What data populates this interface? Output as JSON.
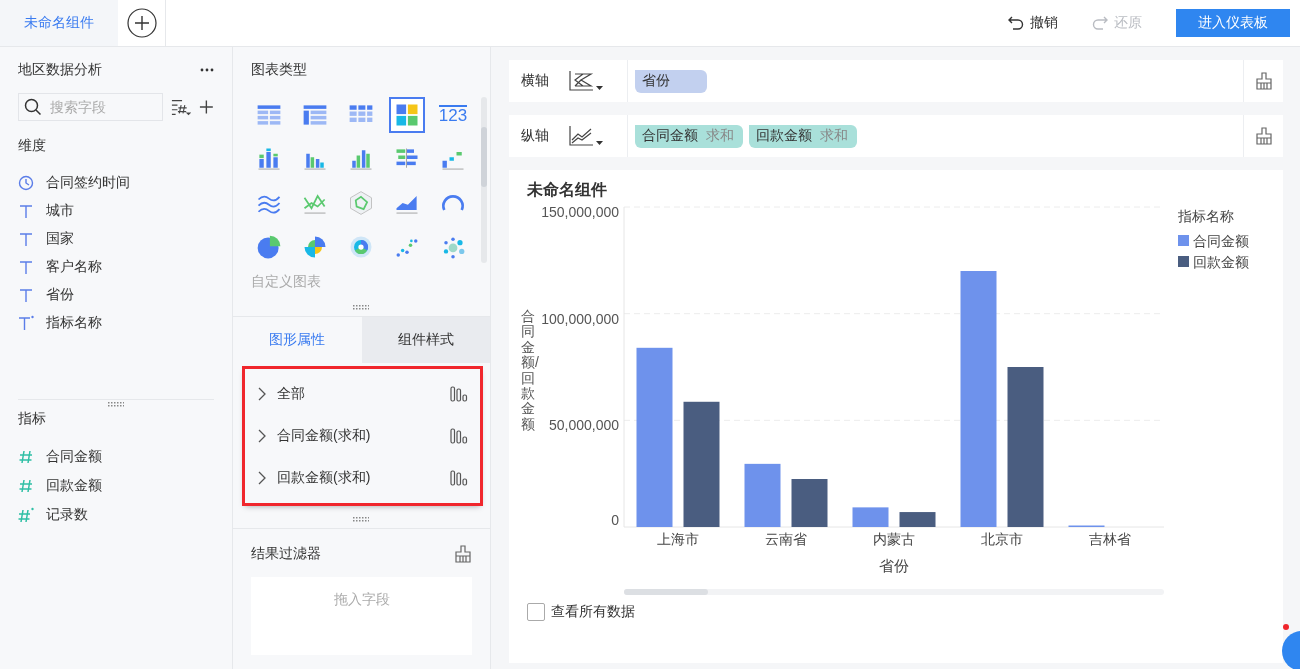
{
  "top_bar": {
    "tabs": [
      {
        "label": "未命名组件",
        "selected": true
      }
    ],
    "undo": {
      "label": "撤销",
      "disabled": false
    },
    "redo": {
      "label": "还原",
      "disabled": true
    },
    "primary_button": "进入仪表板"
  },
  "data_panel": {
    "title": "地区数据分析",
    "search": {
      "placeholder": "搜索字段"
    },
    "dimensions": {
      "title": "维度",
      "fields": [
        {
          "name": "合同签约时间",
          "kind": "time"
        },
        {
          "name": "城市",
          "kind": "text"
        },
        {
          "name": "国家",
          "kind": "text"
        },
        {
          "name": "客户名称",
          "kind": "text"
        },
        {
          "name": "省份",
          "kind": "text"
        },
        {
          "name": "指标名称",
          "kind": "text-calc"
        }
      ]
    },
    "measures": {
      "title": "指标",
      "fields": [
        {
          "name": "合同金额",
          "kind": "number"
        },
        {
          "name": "回款金额",
          "kind": "number"
        },
        {
          "name": "记录数",
          "kind": "number-calc"
        }
      ]
    }
  },
  "chart_types": {
    "title": "图表类型",
    "types": [
      {
        "kind": "table",
        "selected": false
      },
      {
        "kind": "crosstable",
        "selected": false
      },
      {
        "kind": "detail",
        "selected": false
      },
      {
        "kind": "blocks",
        "selected": true
      },
      {
        "kind": "kpi",
        "label": "123",
        "selected": false
      },
      {
        "kind": "stackedbar",
        "selected": false
      },
      {
        "kind": "groupedbar",
        "selected": false
      },
      {
        "kind": "bar",
        "selected": false
      },
      {
        "kind": "hbar",
        "selected": false
      },
      {
        "kind": "steps",
        "selected": false
      },
      {
        "kind": "lines",
        "selected": false
      },
      {
        "kind": "linepoint",
        "selected": false
      },
      {
        "kind": "radar",
        "selected": false
      },
      {
        "kind": "area",
        "selected": false
      },
      {
        "kind": "gauge",
        "selected": false
      },
      {
        "kind": "pie",
        "selected": false
      },
      {
        "kind": "rose",
        "selected": false
      },
      {
        "kind": "donut",
        "selected": false
      },
      {
        "kind": "scatter",
        "selected": false
      },
      {
        "kind": "bubble",
        "selected": false
      }
    ],
    "custom_label": "自定义图表"
  },
  "properties": {
    "highlighted": true,
    "tabs": [
      {
        "label": "图形属性",
        "selected": true
      },
      {
        "label": "组件样式",
        "selected": false
      }
    ],
    "items": [
      {
        "label": "全部",
        "expanded": false
      },
      {
        "label": "合同金额(求和)",
        "expanded": false
      },
      {
        "label": "回款金额(求和)",
        "expanded": false
      }
    ]
  },
  "result_filter": {
    "title": "结果过滤器",
    "placeholder": "拖入字段"
  },
  "axes": [
    {
      "label": "横轴",
      "kind": "x",
      "pills": [
        {
          "field": "省份",
          "kind": "dimension"
        }
      ]
    },
    {
      "label": "纵轴",
      "kind": "y",
      "pills": [
        {
          "field": "合同金额",
          "aggregation": "求和",
          "kind": "measure"
        },
        {
          "field": "回款金额",
          "aggregation": "求和",
          "kind": "measure"
        }
      ]
    }
  ],
  "widget": {
    "title": "未命名组件",
    "chart_data": {
      "type": "bar",
      "legend": {
        "title": "指标名称"
      },
      "xlabel": "省份",
      "ylabel": "合同金额/回款金额",
      "categories": [
        "上海市",
        "云南省",
        "内蒙古",
        "北京市",
        "吉林省"
      ],
      "series": [
        {
          "name": "合同金额",
          "color": "#6e92ec",
          "values": [
            84000000,
            29600000,
            9200000,
            120000000,
            700000
          ]
        },
        {
          "name": "回款金额",
          "color": "#4a5d80",
          "values": [
            58700000,
            22500000,
            7000000,
            75000000,
            0
          ]
        }
      ],
      "ylim": [
        0,
        150000000
      ],
      "yticks": [
        {
          "value": 0,
          "label": "0"
        },
        {
          "value": 50000000,
          "label": "50,000,000"
        },
        {
          "value": 100000000,
          "label": "100,000,000"
        },
        {
          "value": 150000000,
          "label": "150,000,000"
        }
      ]
    },
    "show_all_data": {
      "label": "查看所有数据",
      "checked": false
    }
  }
}
